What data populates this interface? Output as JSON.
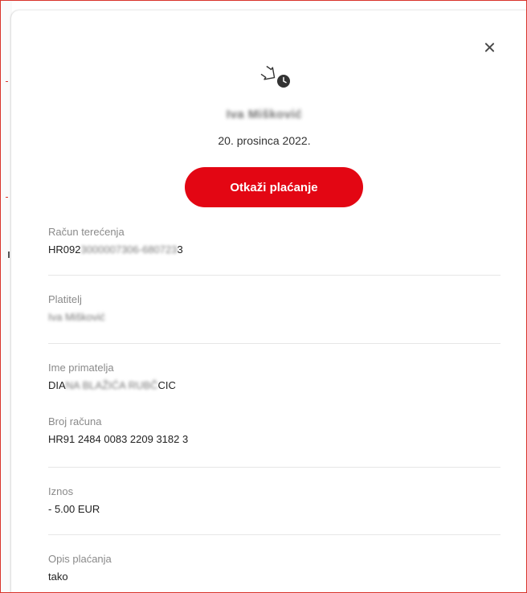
{
  "dialog": {
    "recipient_name": "Iva Mišković",
    "date": "20. prosinca 2022.",
    "cancel_label": "Otkaži plaćanje"
  },
  "fields": {
    "debit_account": {
      "label": "Račun terećenja",
      "value_start": "HR092",
      "value_hidden": "3000007306-680723",
      "value_end": "3"
    },
    "payer": {
      "label": "Platitelj",
      "value_hidden": "Iva Mišković"
    },
    "recipient_name": {
      "label": "Ime primatelja",
      "value_start": "DIA",
      "value_hidden": "NA BLAŽIĆA RUBČ",
      "value_end": "CIC"
    },
    "account_number": {
      "label": "Broj računa",
      "value": "HR91 2484 0083 2209 3182 3"
    },
    "amount": {
      "label": "Iznos",
      "value": "- 5.00 EUR"
    },
    "description": {
      "label": "Opis plaćanja",
      "value": "tako"
    }
  },
  "colors": {
    "accent": "#e30613",
    "label": "#8a8a8a",
    "text": "#222222",
    "divider": "#e6e6e6"
  },
  "icons": {
    "close": "close-icon",
    "scheduled_payment": "scheduled-payment-icon"
  }
}
